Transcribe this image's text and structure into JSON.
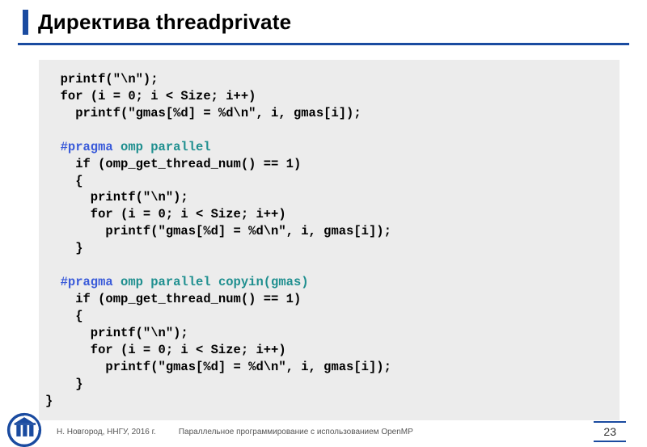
{
  "slide": {
    "title": "Директива threadprivate",
    "code": {
      "l1": "  printf(\"\\n\");",
      "l2": "  for (i = 0; i < Size; i++)",
      "l3": "    printf(\"gmas[%d] = %d\\n\", i, gmas[i]);",
      "l4": "",
      "l5a": "  #pragma",
      "l5b": " omp parallel",
      "l6": "    if (omp_get_thread_num() == 1)",
      "l7": "    {",
      "l8": "      printf(\"\\n\");",
      "l9": "      for (i = 0; i < Size; i++)",
      "l10": "        printf(\"gmas[%d] = %d\\n\", i, gmas[i]);",
      "l11": "    }",
      "l12": "",
      "l13a": "  #pragma",
      "l13b": " omp parallel copyin(gmas)",
      "l14": "    if (omp_get_thread_num() == 1)",
      "l15": "    {",
      "l16": "      printf(\"\\n\");",
      "l17": "      for (i = 0; i < Size; i++)",
      "l18": "        printf(\"gmas[%d] = %d\\n\", i, gmas[i]);",
      "l19": "    }",
      "l20": "}"
    },
    "footer": {
      "left": "Н. Новгород,  ННГУ, 2016 г.",
      "center": "Параллельное программирование с использованием OpenMP",
      "page": "23"
    }
  }
}
